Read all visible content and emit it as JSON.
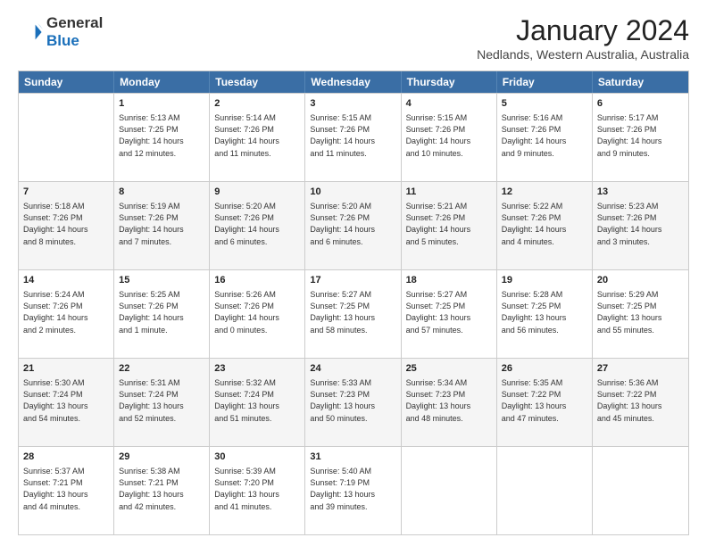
{
  "logo": {
    "line1": "General",
    "line2": "Blue"
  },
  "title": "January 2024",
  "subtitle": "Nedlands, Western Australia, Australia",
  "headers": [
    "Sunday",
    "Monday",
    "Tuesday",
    "Wednesday",
    "Thursday",
    "Friday",
    "Saturday"
  ],
  "rows": [
    [
      {
        "day": "",
        "lines": []
      },
      {
        "day": "1",
        "lines": [
          "Sunrise: 5:13 AM",
          "Sunset: 7:25 PM",
          "Daylight: 14 hours",
          "and 12 minutes."
        ]
      },
      {
        "day": "2",
        "lines": [
          "Sunrise: 5:14 AM",
          "Sunset: 7:26 PM",
          "Daylight: 14 hours",
          "and 11 minutes."
        ]
      },
      {
        "day": "3",
        "lines": [
          "Sunrise: 5:15 AM",
          "Sunset: 7:26 PM",
          "Daylight: 14 hours",
          "and 11 minutes."
        ]
      },
      {
        "day": "4",
        "lines": [
          "Sunrise: 5:15 AM",
          "Sunset: 7:26 PM",
          "Daylight: 14 hours",
          "and 10 minutes."
        ]
      },
      {
        "day": "5",
        "lines": [
          "Sunrise: 5:16 AM",
          "Sunset: 7:26 PM",
          "Daylight: 14 hours",
          "and 9 minutes."
        ]
      },
      {
        "day": "6",
        "lines": [
          "Sunrise: 5:17 AM",
          "Sunset: 7:26 PM",
          "Daylight: 14 hours",
          "and 9 minutes."
        ]
      }
    ],
    [
      {
        "day": "7",
        "lines": [
          "Sunrise: 5:18 AM",
          "Sunset: 7:26 PM",
          "Daylight: 14 hours",
          "and 8 minutes."
        ]
      },
      {
        "day": "8",
        "lines": [
          "Sunrise: 5:19 AM",
          "Sunset: 7:26 PM",
          "Daylight: 14 hours",
          "and 7 minutes."
        ]
      },
      {
        "day": "9",
        "lines": [
          "Sunrise: 5:20 AM",
          "Sunset: 7:26 PM",
          "Daylight: 14 hours",
          "and 6 minutes."
        ]
      },
      {
        "day": "10",
        "lines": [
          "Sunrise: 5:20 AM",
          "Sunset: 7:26 PM",
          "Daylight: 14 hours",
          "and 6 minutes."
        ]
      },
      {
        "day": "11",
        "lines": [
          "Sunrise: 5:21 AM",
          "Sunset: 7:26 PM",
          "Daylight: 14 hours",
          "and 5 minutes."
        ]
      },
      {
        "day": "12",
        "lines": [
          "Sunrise: 5:22 AM",
          "Sunset: 7:26 PM",
          "Daylight: 14 hours",
          "and 4 minutes."
        ]
      },
      {
        "day": "13",
        "lines": [
          "Sunrise: 5:23 AM",
          "Sunset: 7:26 PM",
          "Daylight: 14 hours",
          "and 3 minutes."
        ]
      }
    ],
    [
      {
        "day": "14",
        "lines": [
          "Sunrise: 5:24 AM",
          "Sunset: 7:26 PM",
          "Daylight: 14 hours",
          "and 2 minutes."
        ]
      },
      {
        "day": "15",
        "lines": [
          "Sunrise: 5:25 AM",
          "Sunset: 7:26 PM",
          "Daylight: 14 hours",
          "and 1 minute."
        ]
      },
      {
        "day": "16",
        "lines": [
          "Sunrise: 5:26 AM",
          "Sunset: 7:26 PM",
          "Daylight: 14 hours",
          "and 0 minutes."
        ]
      },
      {
        "day": "17",
        "lines": [
          "Sunrise: 5:27 AM",
          "Sunset: 7:25 PM",
          "Daylight: 13 hours",
          "and 58 minutes."
        ]
      },
      {
        "day": "18",
        "lines": [
          "Sunrise: 5:27 AM",
          "Sunset: 7:25 PM",
          "Daylight: 13 hours",
          "and 57 minutes."
        ]
      },
      {
        "day": "19",
        "lines": [
          "Sunrise: 5:28 AM",
          "Sunset: 7:25 PM",
          "Daylight: 13 hours",
          "and 56 minutes."
        ]
      },
      {
        "day": "20",
        "lines": [
          "Sunrise: 5:29 AM",
          "Sunset: 7:25 PM",
          "Daylight: 13 hours",
          "and 55 minutes."
        ]
      }
    ],
    [
      {
        "day": "21",
        "lines": [
          "Sunrise: 5:30 AM",
          "Sunset: 7:24 PM",
          "Daylight: 13 hours",
          "and 54 minutes."
        ]
      },
      {
        "day": "22",
        "lines": [
          "Sunrise: 5:31 AM",
          "Sunset: 7:24 PM",
          "Daylight: 13 hours",
          "and 52 minutes."
        ]
      },
      {
        "day": "23",
        "lines": [
          "Sunrise: 5:32 AM",
          "Sunset: 7:24 PM",
          "Daylight: 13 hours",
          "and 51 minutes."
        ]
      },
      {
        "day": "24",
        "lines": [
          "Sunrise: 5:33 AM",
          "Sunset: 7:23 PM",
          "Daylight: 13 hours",
          "and 50 minutes."
        ]
      },
      {
        "day": "25",
        "lines": [
          "Sunrise: 5:34 AM",
          "Sunset: 7:23 PM",
          "Daylight: 13 hours",
          "and 48 minutes."
        ]
      },
      {
        "day": "26",
        "lines": [
          "Sunrise: 5:35 AM",
          "Sunset: 7:22 PM",
          "Daylight: 13 hours",
          "and 47 minutes."
        ]
      },
      {
        "day": "27",
        "lines": [
          "Sunrise: 5:36 AM",
          "Sunset: 7:22 PM",
          "Daylight: 13 hours",
          "and 45 minutes."
        ]
      }
    ],
    [
      {
        "day": "28",
        "lines": [
          "Sunrise: 5:37 AM",
          "Sunset: 7:21 PM",
          "Daylight: 13 hours",
          "and 44 minutes."
        ]
      },
      {
        "day": "29",
        "lines": [
          "Sunrise: 5:38 AM",
          "Sunset: 7:21 PM",
          "Daylight: 13 hours",
          "and 42 minutes."
        ]
      },
      {
        "day": "30",
        "lines": [
          "Sunrise: 5:39 AM",
          "Sunset: 7:20 PM",
          "Daylight: 13 hours",
          "and 41 minutes."
        ]
      },
      {
        "day": "31",
        "lines": [
          "Sunrise: 5:40 AM",
          "Sunset: 7:19 PM",
          "Daylight: 13 hours",
          "and 39 minutes."
        ]
      },
      {
        "day": "",
        "lines": []
      },
      {
        "day": "",
        "lines": []
      },
      {
        "day": "",
        "lines": []
      }
    ]
  ]
}
